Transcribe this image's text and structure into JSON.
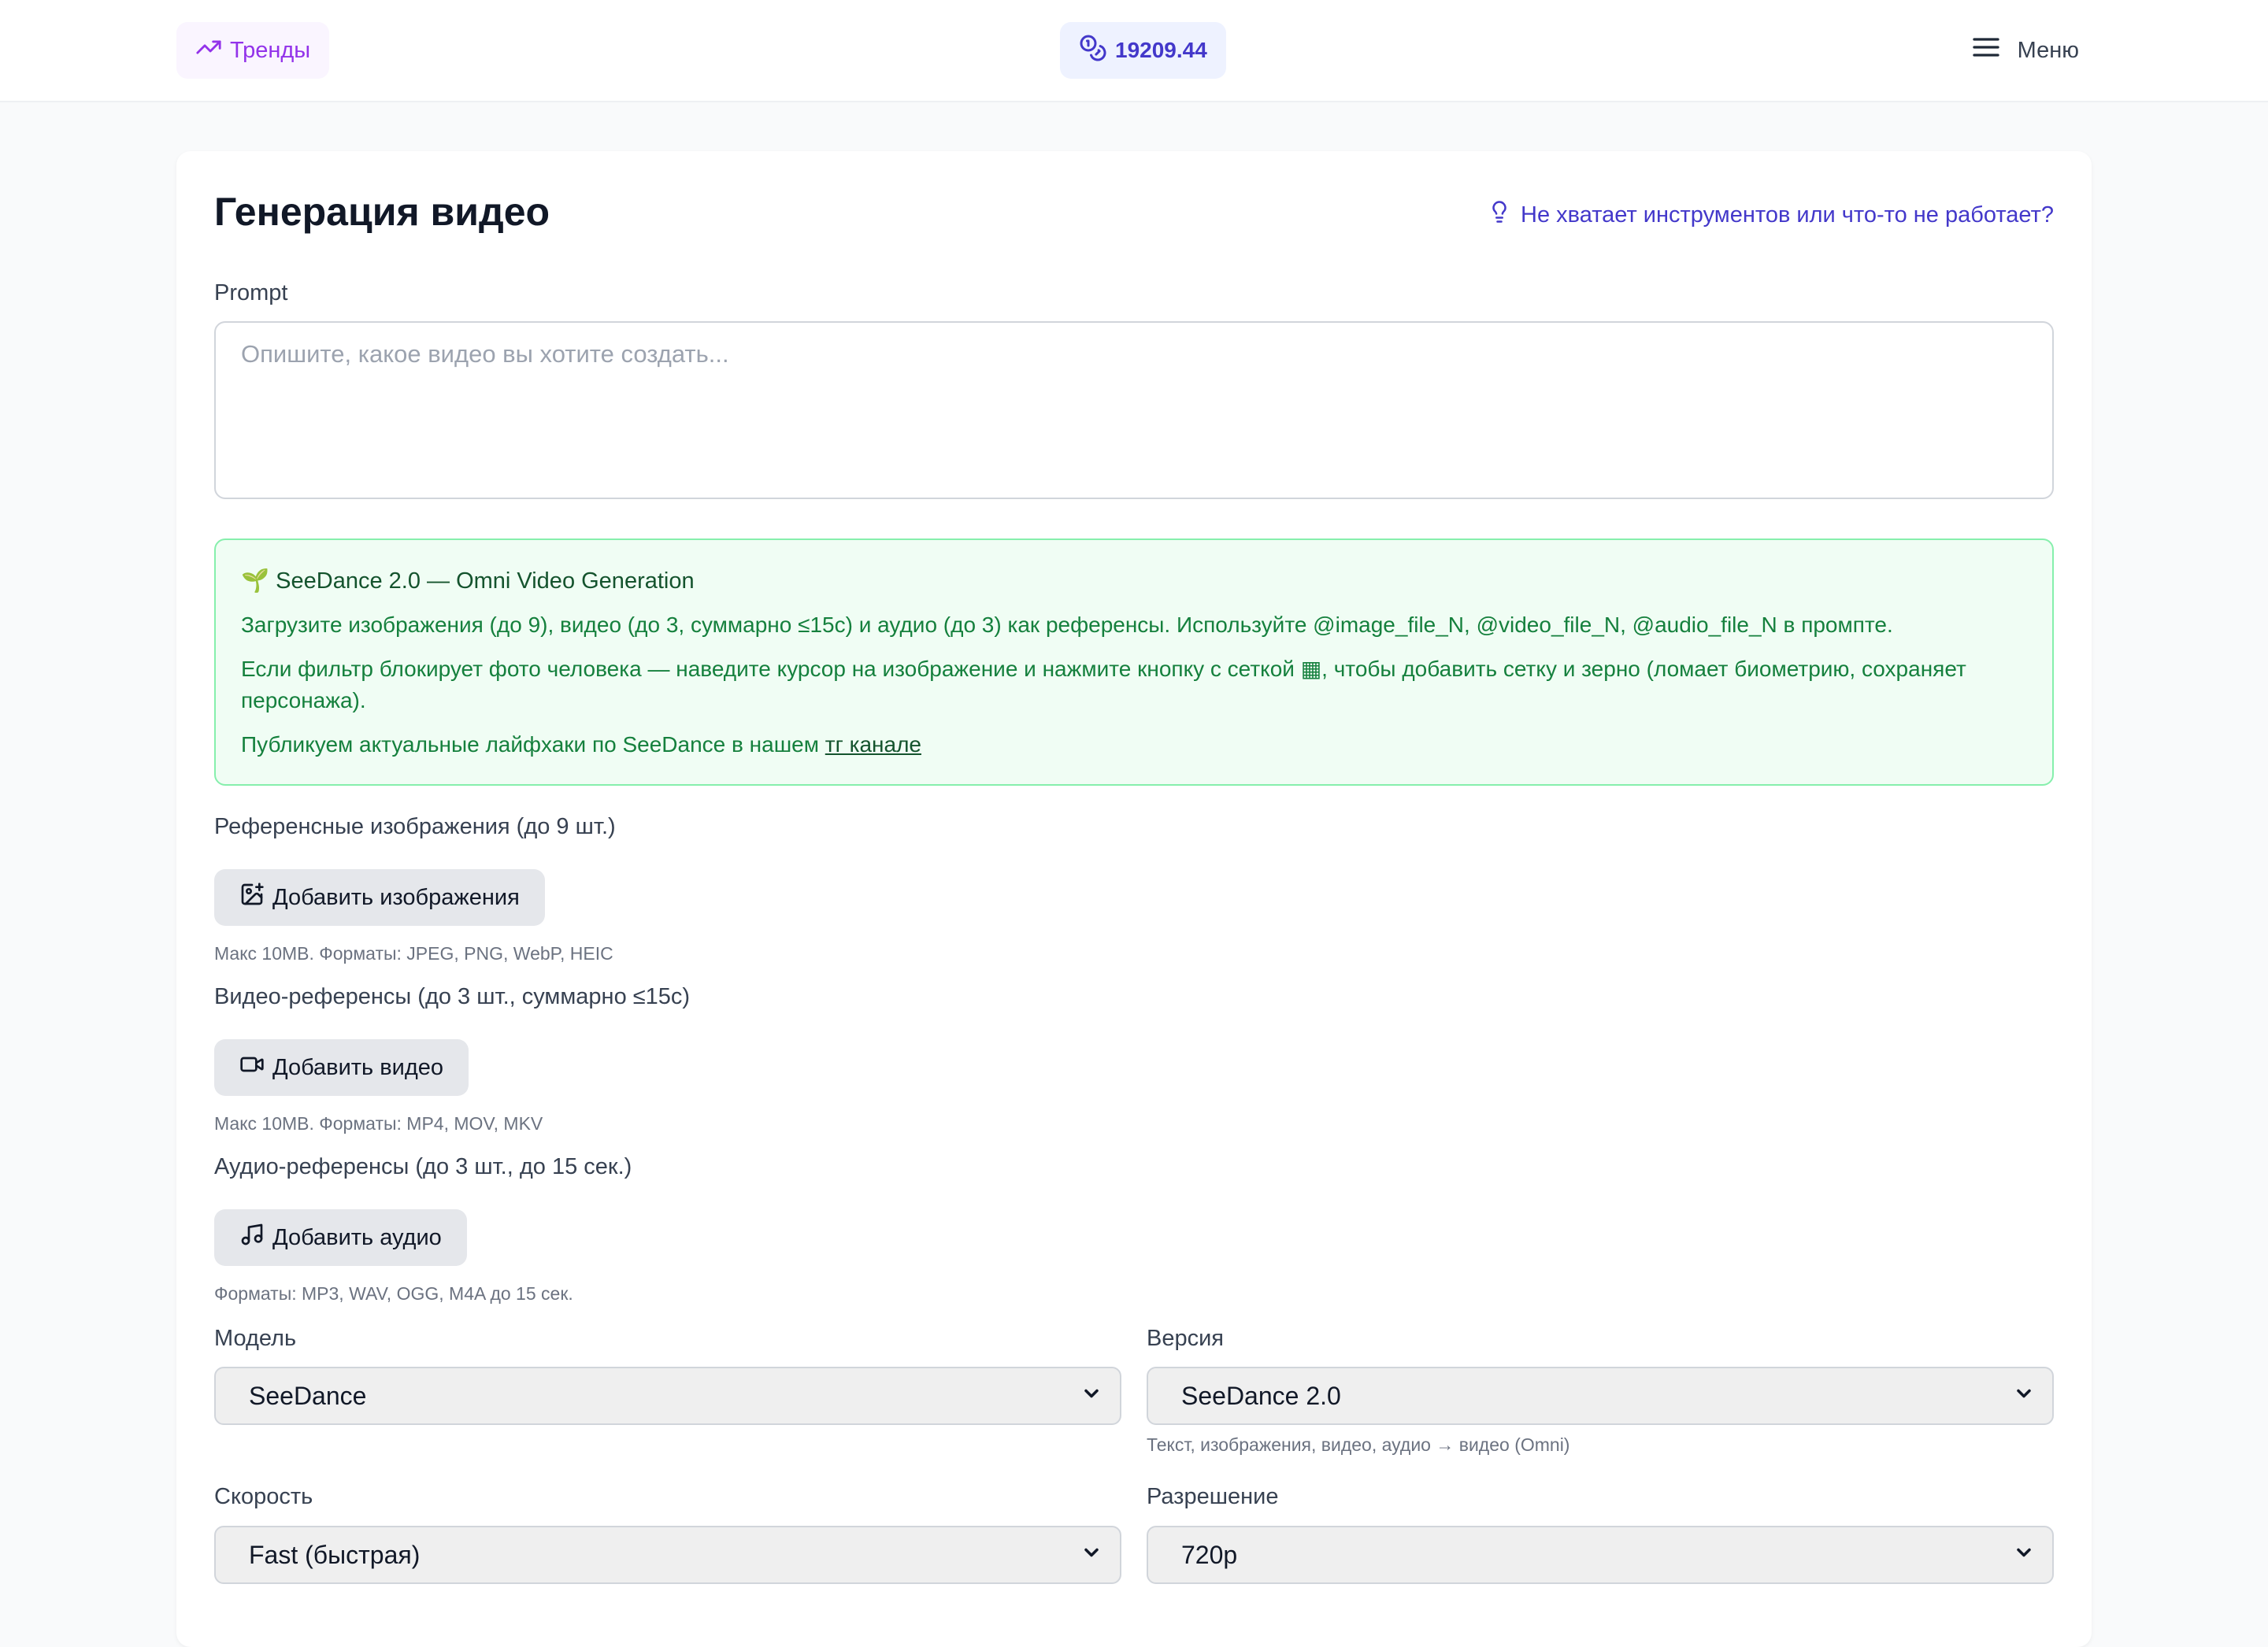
{
  "header": {
    "trends_label": "Тренды",
    "balance": "19209.44",
    "menu_label": "Меню"
  },
  "form": {
    "title": "Генерация видео",
    "help_link": "Не хватает инструментов или что-то не работает?",
    "prompt_label": "Prompt",
    "prompt_placeholder": "Опишите, какое видео вы хотите создать...",
    "prompt_value": ""
  },
  "info": {
    "heading": "🌱 SeeDance 2.0 — Omni Video Generation",
    "line1": "Загрузите изображения (до 9), видео (до 3, суммарно ≤15с) и аудио (до 3) как референсы. Используйте @image_file_N, @video_file_N, @audio_file_N в промпте.",
    "line2": "Если фильтр блокирует фото человека — наведите курсор на изображение и нажмите кнопку с сеткой ▦, чтобы добавить сетку и зерно (ломает биометрию, сохраняет персонажа).",
    "line3_prefix": "Публикуем актуальные лайфхаки по SeeDance в нашем ",
    "line3_link": "тг канале"
  },
  "references": {
    "images": {
      "label": "Референсные изображения (до 9 шт.)",
      "button": "Добавить изображения",
      "hint": "Макс 10MB. Форматы: JPEG, PNG, WebP, HEIC"
    },
    "videos": {
      "label": "Видео-референсы (до 3 шт., суммарно ≤15с)",
      "button": "Добавить видео",
      "hint": "Макс 10MB. Форматы: MP4, MOV, MKV"
    },
    "audio": {
      "label": "Аудио-референсы (до 3 шт., до 15 сек.)",
      "button": "Добавить аудио",
      "hint": "Форматы: MP3, WAV, OGG, M4A до 15 сек."
    }
  },
  "settings": {
    "model": {
      "label": "Модель",
      "value": "SeeDance"
    },
    "version": {
      "label": "Версия",
      "value": "SeeDance 2.0",
      "hint": "Текст, изображения, видео, аудио → видео (Omni)"
    },
    "speed": {
      "label": "Скорость",
      "value": "Fast (быстрая)"
    },
    "resolution": {
      "label": "Разрешение",
      "value": "720p"
    }
  },
  "colors": {
    "accent": "#4338ca",
    "trends": "#9333ea",
    "info_bg": "#f0fdf4",
    "info_border": "#86efac",
    "info_text": "#15803d"
  }
}
